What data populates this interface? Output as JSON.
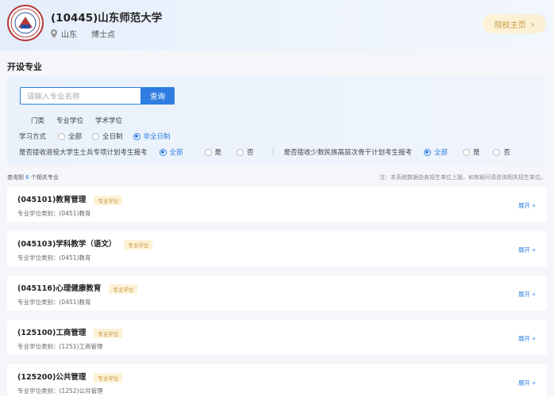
{
  "header": {
    "school_name": "(10445)山东师范大学",
    "location": "山东",
    "tag": "博士点",
    "home_button": "院校主页",
    "home_chevron": "›",
    "logo_color": "#b53a3a"
  },
  "section_title": "开设专业",
  "search": {
    "placeholder": "请输入专业名称",
    "button": "查询"
  },
  "category_tabs": [
    "门类",
    "专业学位",
    "学术学位"
  ],
  "study_mode": {
    "label": "学习方式",
    "options": [
      "全部",
      "全日制",
      "非全日制"
    ],
    "selected": "非全日制"
  },
  "filter_retired": {
    "label": "是否接收退役大学生士兵专项计划考生报考",
    "options": [
      "全部",
      "是",
      "否"
    ],
    "selected": "全部"
  },
  "filter_minority": {
    "label": "是否接收少数民族高层次骨干计划考生报考",
    "options": [
      "全部",
      "是",
      "否"
    ],
    "selected": "全部"
  },
  "results": {
    "prefix": "查询到",
    "count": "6",
    "suffix": "个相关专业",
    "note": "注：本系统数据由各招生单位上报，如有疑问请咨询相关招生单位。"
  },
  "majors": [
    {
      "title": "(045101)教育管理",
      "badge": "专业学位",
      "category": "专业学位类别：(0451)教育",
      "expand": "展开"
    },
    {
      "title": "(045103)学科教学（语文）",
      "badge": "专业学位",
      "category": "专业学位类别：(0451)教育",
      "expand": "展开"
    },
    {
      "title": "(045116)心理健康教育",
      "badge": "专业学位",
      "category": "专业学位类别：(0451)教育",
      "expand": "展开"
    },
    {
      "title": "(125100)工商管理",
      "badge": "专业学位",
      "category": "专业学位类别：(1251)工商管理",
      "expand": "展开"
    },
    {
      "title": "(125200)公共管理",
      "badge": "专业学位",
      "category": "专业学位类别：(1252)公共管理",
      "expand": "展开"
    }
  ],
  "colors": {
    "accent": "#2f7de1",
    "badge_text": "#c69442",
    "badge_bg": "#fdf2d6"
  }
}
